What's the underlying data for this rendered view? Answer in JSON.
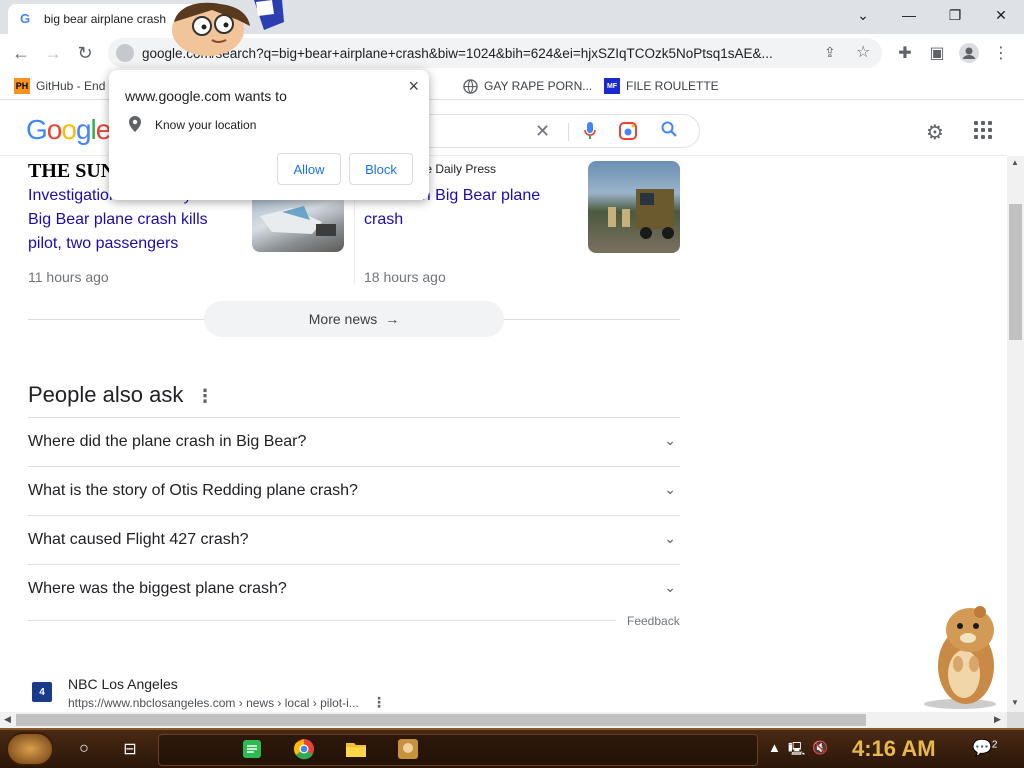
{
  "browser": {
    "tab_title": "big bear airplane crash",
    "url": "google.com/search?q=big+bear+airplane+crash&biw=1024&bih=624&ei=hjxSZIqTCOzk5NoPtsq1sAE&...",
    "bookmarks": [
      {
        "icon": "PH",
        "label": "GitHub - End"
      },
      {
        "icon": "globe",
        "label": "GAY RAPE PORN..."
      },
      {
        "icon": "MF",
        "label": "FILE ROULETTE"
      }
    ]
  },
  "google": {
    "logo_text": "Google"
  },
  "permission": {
    "title": "www.google.com wants to",
    "item": "Know your location",
    "allow_label": "Allow",
    "block_label": "Block",
    "close_symbol": "×"
  },
  "news": {
    "card1": {
      "source": "THE SUN",
      "headline_line1": "Investigation underway after",
      "headline_line2": "Big Bear plane crash kills",
      "headline_line3": "pilot, two passengers",
      "time": "11 hours ago"
    },
    "card2": {
      "source": "lle Daily Press",
      "headline_line1": "3 killed in Big Bear plane",
      "headline_line2": "crash",
      "time": "18 hours ago"
    },
    "more_news": "More news"
  },
  "paa": {
    "title": "People also ask",
    "questions": [
      "Where did the plane crash in Big Bear?",
      "What is the story of Otis Redding plane crash?",
      "What caused Flight 427 crash?",
      "Where was the biggest plane crash?"
    ],
    "feedback": "Feedback"
  },
  "result": {
    "favicon_text": "4",
    "site_name": "NBC Los Angeles",
    "url": "https://www.nbclosangeles.com › news › local › pilot-i..."
  },
  "taskbar": {
    "clock": "4:16 AM",
    "notification_count": "2"
  },
  "colors": {
    "link": "#1a0dab",
    "google_blue": "#4285f4",
    "google_red": "#ea4335",
    "google_yellow": "#fbbc05",
    "google_green": "#34a853",
    "clock": "#e8b84a"
  }
}
